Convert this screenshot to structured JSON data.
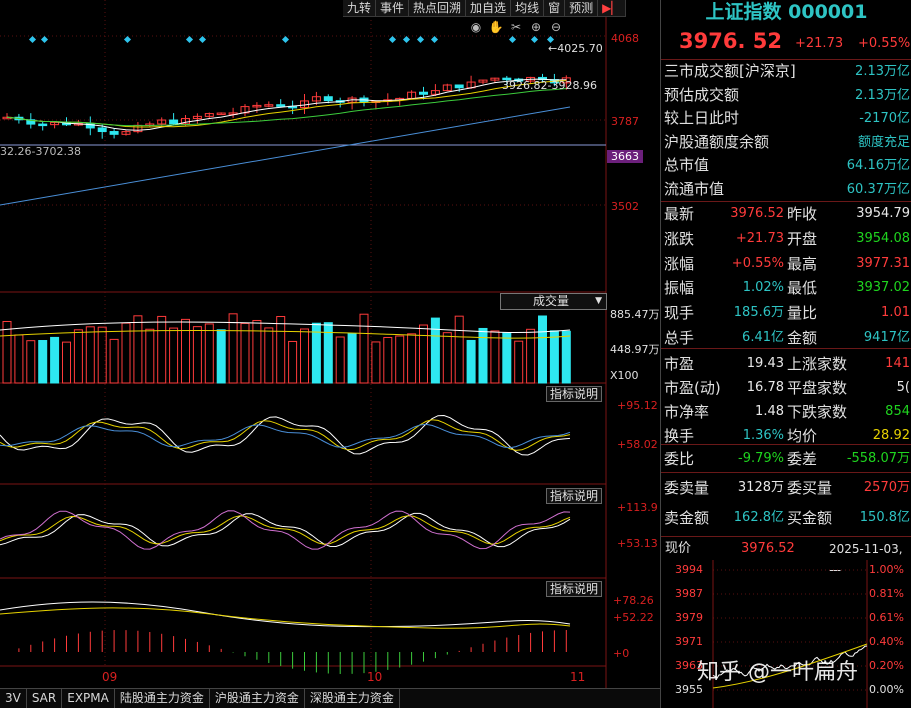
{
  "toolbar": [
    "九转",
    "事件",
    "热点回溯",
    "加自选",
    "均线",
    "窗",
    "预测"
  ],
  "toolbar_exit_icon": "exit-icon",
  "chart_icons": [
    "eye-icon",
    "hand-icon",
    "scissors-icon",
    "zoom-in-icon",
    "zoom-out-icon"
  ],
  "main_chart": {
    "axis": [
      "4068",
      "3787",
      "3663",
      "3502"
    ],
    "high_label": "4025.70",
    "ma_label": "3926.82-3928.96",
    "low_label": "32.26-3702.38"
  },
  "volume_panel": {
    "selector": "成交量",
    "axis": [
      "885.47万",
      "448.97万"
    ],
    "unit": "X100"
  },
  "indicator_panels": [
    {
      "tab": "指标说明",
      "axis": [
        "+95.12",
        "+58.02"
      ]
    },
    {
      "tab": "指标说明",
      "axis": [
        "+113.9",
        "+53.13"
      ]
    },
    {
      "tab": "指标说明",
      "axis": [
        "+78.26",
        "+52.22",
        "+0"
      ]
    }
  ],
  "x_axis": [
    "09",
    "10",
    "11"
  ],
  "bottom_tabs": [
    "3V",
    "SAR",
    "EXPMA",
    "陆股通主力资金",
    "沪股通主力资金",
    "深股通主力资金"
  ],
  "info": {
    "title": "上证指数 000001",
    "price": "3976. 52",
    "change": "+21.73",
    "pct": "+0.55%",
    "summary": [
      {
        "k": "三市成交额[沪深京]",
        "v": "2.13万亿"
      },
      {
        "k": "预估成交额",
        "v": "2.13万亿"
      },
      {
        "k": "较上日此时",
        "v": "-2170亿"
      },
      {
        "k": "沪股通额度余额",
        "v": "额度充足"
      },
      {
        "k": "总市值",
        "v": "64.16万亿"
      },
      {
        "k": "流通市值",
        "v": "60.37万亿"
      }
    ],
    "grid": [
      {
        "k1": "最新",
        "v1": "3976.52",
        "k2": "昨收",
        "v2": "3954.79",
        "c1": "red",
        "c2": "white"
      },
      {
        "k1": "涨跌",
        "v1": "+21.73",
        "k2": "开盘",
        "v2": "3954.08",
        "c1": "red",
        "c2": "green"
      },
      {
        "k1": "涨幅",
        "v1": "+0.55%",
        "k2": "最高",
        "v2": "3977.31",
        "c1": "red",
        "c2": "red"
      },
      {
        "k1": "振幅",
        "v1": "1.02%",
        "k2": "最低",
        "v2": "3937.02",
        "c1": "cyan",
        "c2": "green"
      },
      {
        "k1": "现手",
        "v1": "185.6万",
        "k2": "量比",
        "v2": "1.01",
        "c1": "cyan",
        "c2": "red"
      },
      {
        "k1": "总手",
        "v1": "6.41亿",
        "k2": "金额",
        "v2": "9417亿",
        "c1": "cyan",
        "c2": "cyan"
      },
      {
        "k1": "市盈",
        "v1": "19.43",
        "k2": "上涨家数",
        "v2": "141",
        "c1": "white",
        "c2": "red"
      },
      {
        "k1": "市盈(动)",
        "v1": "16.78",
        "k2": "平盘家数",
        "v2": "5(",
        "c1": "white",
        "c2": "white"
      },
      {
        "k1": "市净率",
        "v1": "1.48",
        "k2": "下跌家数",
        "v2": "854",
        "c1": "white",
        "c2": "green"
      },
      {
        "k1": "换手",
        "v1": "1.36%",
        "k2": "均价",
        "v2": "28.92",
        "c1": "cyan",
        "c2": "yellow"
      },
      {
        "k1": "委比",
        "v1": "-9.79%",
        "k2": "委差",
        "v2": "-558.07万",
        "c1": "green",
        "c2": "green"
      },
      {
        "k1": "委卖量",
        "v1": "3128万",
        "k2": "委买量",
        "v2": "2570万",
        "c1": "white",
        "c2": "red"
      },
      {
        "k1": "卖金额",
        "v1": "162.8亿",
        "k2": "买金额",
        "v2": "150.8亿",
        "c1": "cyan",
        "c2": "cyan"
      }
    ],
    "mini": {
      "label": "现价",
      "price": "3976.52",
      "date": "2025-11-03,一",
      "left_axis": [
        "3994",
        "3987",
        "3979",
        "3971",
        "3963",
        "3955"
      ],
      "right_axis": [
        "1.00%",
        "0.81%",
        "0.61%",
        "0.40%",
        "0.20%",
        "0.00%"
      ]
    },
    "watermark": "知乎 @一叶扁舟"
  },
  "colors": {
    "up": "#ff3b3b",
    "down": "#2ee8f0",
    "ma_white": "#ffffff",
    "ma_yellow": "#e6d200",
    "ma_green": "#3ccc3c",
    "ma_blue": "#4a8fd8",
    "grid_red": "#7a1414"
  }
}
